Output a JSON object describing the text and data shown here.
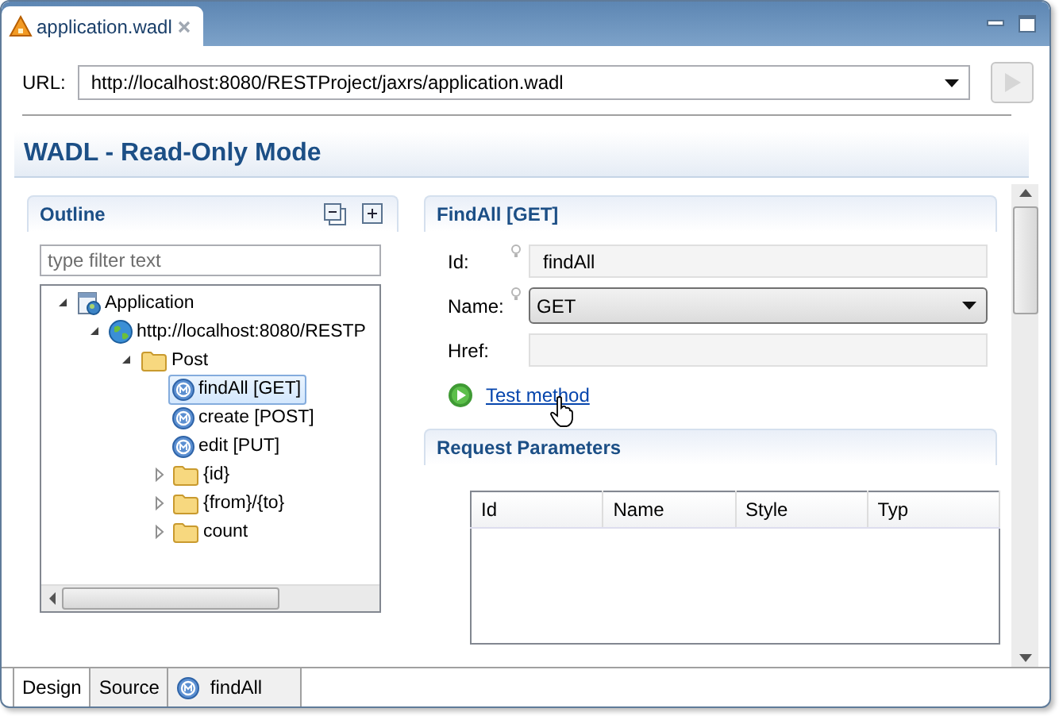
{
  "editor_tab": {
    "title": "application.wadl",
    "selected": true
  },
  "url_bar": {
    "label": "URL:",
    "value": "http://localhost:8080/RESTProject/jaxrs/application.wadl",
    "run_disabled": true
  },
  "header": {
    "title": "WADL - Read-Only Mode"
  },
  "outline": {
    "title": "Outline",
    "filter": {
      "placeholder": "type filter text"
    },
    "tree": [
      {
        "kind": "application",
        "label": "Application",
        "expanded": true,
        "selected": false,
        "children": [
          {
            "kind": "resource",
            "label": "http://localhost:8080/RESTP",
            "expanded": true,
            "selected": false,
            "children": [
              {
                "kind": "folder",
                "label": "Post",
                "expanded": true,
                "selected": false,
                "children": [
                  {
                    "kind": "method",
                    "label": "findAll [GET]",
                    "selected": true
                  },
                  {
                    "kind": "method",
                    "label": "create [POST]",
                    "selected": false
                  },
                  {
                    "kind": "method",
                    "label": "edit [PUT]",
                    "selected": false
                  },
                  {
                    "kind": "folder",
                    "label": "{id}",
                    "expanded": false,
                    "selected": false
                  },
                  {
                    "kind": "folder",
                    "label": "{from}/{to}",
                    "expanded": false,
                    "selected": false
                  },
                  {
                    "kind": "folder",
                    "label": "count",
                    "expanded": false,
                    "selected": false
                  }
                ]
              }
            ]
          }
        ]
      }
    ]
  },
  "details": {
    "title": "FindAll [GET]",
    "fields": [
      {
        "kind": "text",
        "label": "Id:",
        "value": "findAll"
      },
      {
        "kind": "combo",
        "label": "Name:",
        "value": "GET"
      },
      {
        "kind": "text",
        "label": "Href:"
      }
    ],
    "link": "Test method"
  },
  "request_parameters": {
    "title": "Request Parameters",
    "columns": [
      "Id",
      "Name",
      "Style",
      "Typ"
    ]
  },
  "bottom_tabs": [
    {
      "label": "Design",
      "kind": "plain",
      "selected": true
    },
    {
      "label": "Source",
      "kind": "plain",
      "selected": false
    },
    {
      "label": "findAll",
      "kind": "method",
      "selected": false
    }
  ]
}
